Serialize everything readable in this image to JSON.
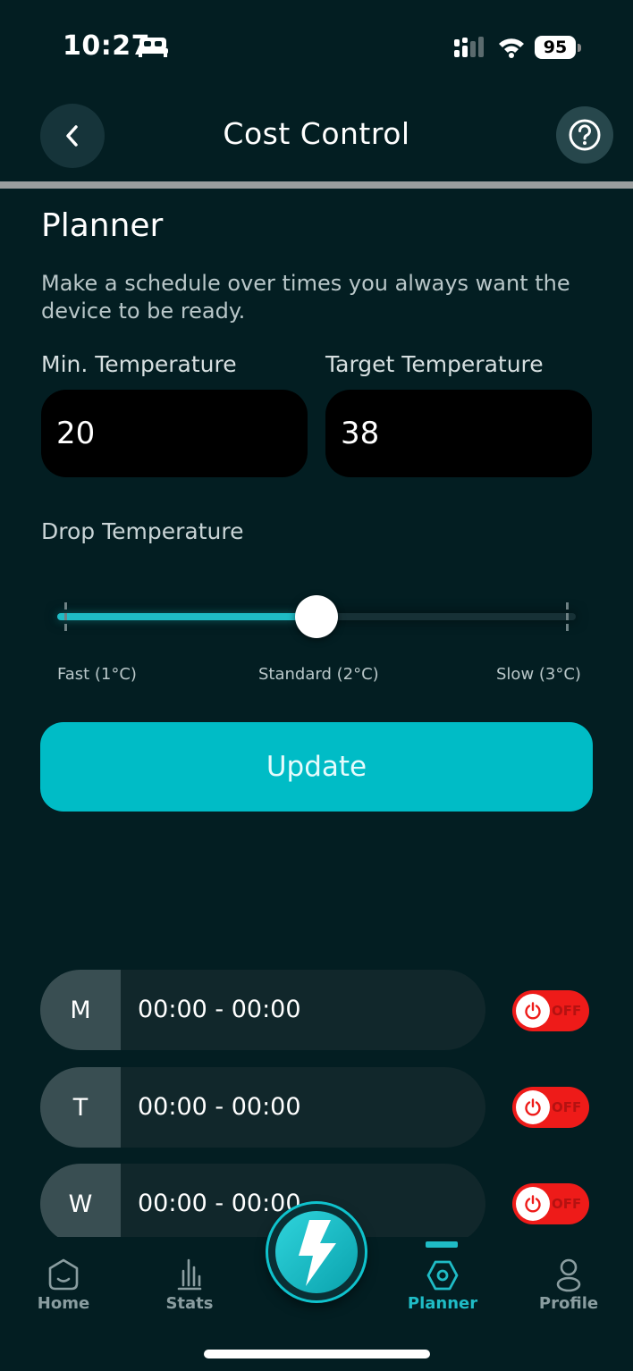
{
  "status_bar": {
    "time": "10:27",
    "battery": "95"
  },
  "header": {
    "title": "Cost Control"
  },
  "planner": {
    "title": "Planner",
    "description": "Make a schedule over times you always want the device to be ready.",
    "min_temp_label": "Min. Temperature",
    "min_temp_value": "20",
    "target_temp_label": "Target Temperature",
    "target_temp_value": "38",
    "drop_label": "Drop Temperature",
    "slider": {
      "options": [
        "Fast (1°C)",
        "Standard (2°C)",
        "Slow (3°C)"
      ],
      "selected": "Standard (2°C)",
      "value_fraction": 0.5
    },
    "update_label": "Update"
  },
  "schedule": [
    {
      "day": "M",
      "range": "00:00 - 00:00",
      "state": "OFF"
    },
    {
      "day": "T",
      "range": "00:00 - 00:00",
      "state": "OFF"
    },
    {
      "day": "W",
      "range": "00:00 - 00:00",
      "state": "OFF"
    }
  ],
  "nav": {
    "items": [
      {
        "label": "Home",
        "icon": "home-icon"
      },
      {
        "label": "Stats",
        "icon": "stats-icon"
      },
      {
        "label": "Planner",
        "icon": "planner-icon"
      },
      {
        "label": "Profile",
        "icon": "profile-icon"
      }
    ],
    "active": "Planner",
    "center_icon": "lightning-icon"
  },
  "colors": {
    "background": "#031e22",
    "accent": "#00bcc6",
    "toggle_off": "#ee1b19"
  }
}
